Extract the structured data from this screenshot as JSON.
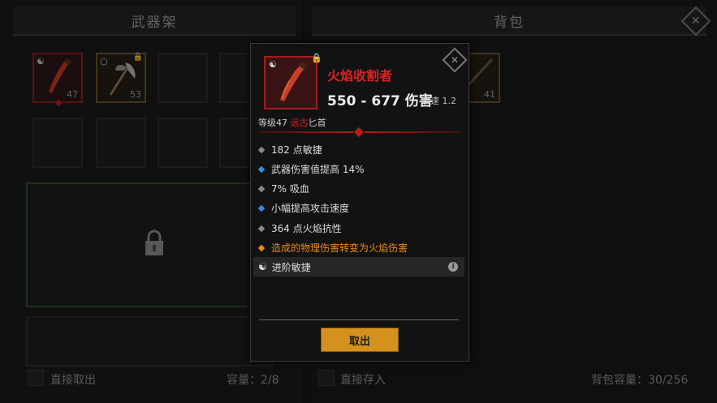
{
  "left_panel": {
    "title": "武器架",
    "slots": [
      {
        "level": "47",
        "icon": "dagger-icon",
        "symbol": "☯"
      },
      {
        "level": "53",
        "icon": "axe-icon",
        "symbol": "○",
        "locked": true
      }
    ],
    "footer_left": "直接取出",
    "footer_right": "容量：2/8"
  },
  "right_panel": {
    "title": "背包",
    "slots": [
      {
        "level": "41",
        "icon": "spear-icon"
      }
    ],
    "footer_left": "直接存入",
    "footer_right": "背包容量：30/256"
  },
  "tooltip": {
    "name": "火焰收割者",
    "damage": "550 - 677 伤害",
    "speed": "攻速 1.2",
    "level_prefix": "等级47 ",
    "rarity": "远古",
    "type": "匕首",
    "stats": [
      {
        "text": "182 点敏捷",
        "bullet": "gray"
      },
      {
        "text": "武器伤害值提高 14%",
        "bullet": "blue"
      },
      {
        "text": "7% 吸血",
        "bullet": "gray"
      },
      {
        "text": "小幅提高攻击速度",
        "bullet": "blue"
      },
      {
        "text": "364 点火焰抗性",
        "bullet": "gray"
      },
      {
        "text": "造成的物理伤害转变为火焰伤害",
        "bullet": "orange"
      }
    ],
    "special": "进阶敏捷",
    "drop_button": "取出"
  },
  "colors": {
    "rarity_red": "#e02020",
    "legendary_orange": "#e88a1a",
    "accent_blue": "#3a8ad8",
    "button_gold": "#d4911e"
  }
}
